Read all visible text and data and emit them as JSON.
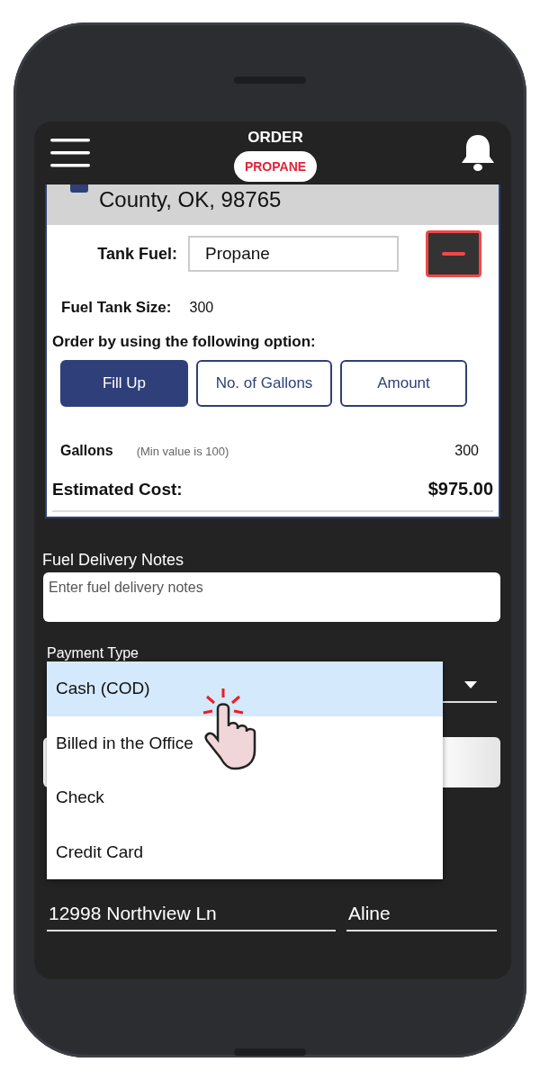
{
  "header": {
    "logo_top": "ORDER",
    "logo_badge": "PROPANE"
  },
  "address_line": "County, OK, 98765",
  "tank_fuel": {
    "label": "Tank Fuel:",
    "value": "Propane"
  },
  "tank_size": {
    "label": "Fuel Tank Size:",
    "value": "300"
  },
  "order_prompt": "Order by using the following option:",
  "order_options": [
    {
      "label": "Fill Up",
      "selected": true
    },
    {
      "label": "No. of Gallons",
      "selected": false
    },
    {
      "label": "Amount",
      "selected": false
    }
  ],
  "gallons": {
    "label": "Gallons",
    "hint": "(Min value is 100)",
    "value": "300"
  },
  "estimated_cost": {
    "label": "Estimated Cost:",
    "value": "$975.00"
  },
  "delivery_notes": {
    "label": "Fuel Delivery Notes",
    "placeholder": "Enter fuel delivery notes"
  },
  "payment_type": {
    "label": "Payment Type",
    "expanded": true,
    "options": [
      {
        "label": "Cash (COD)",
        "selected": true
      },
      {
        "label": "Billed in the Office",
        "selected": false
      },
      {
        "label": "Check",
        "selected": false
      },
      {
        "label": "Credit Card",
        "selected": false
      }
    ]
  },
  "address_fields": [
    {
      "value": "12998 Northview Ln"
    },
    {
      "value": "Aline"
    }
  ]
}
